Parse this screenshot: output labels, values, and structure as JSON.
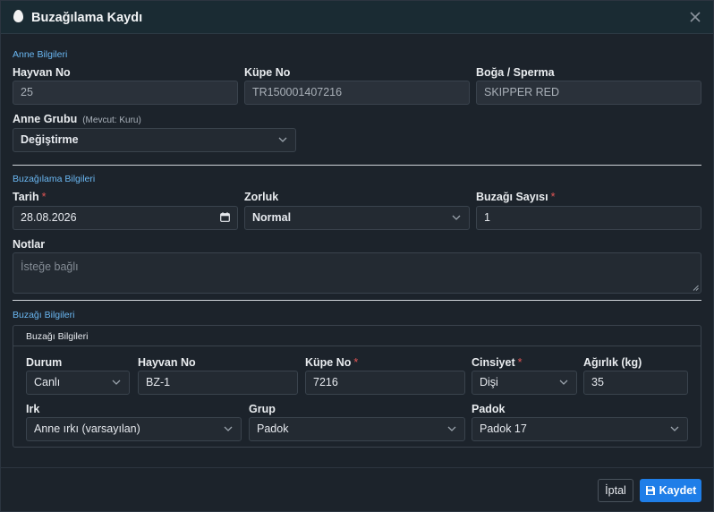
{
  "modal": {
    "title": "Buzağılama Kaydı"
  },
  "mother": {
    "section": "Anne Bilgileri",
    "animal_no_label": "Hayvan No",
    "animal_no_value": "25",
    "tag_no_label": "Küpe No",
    "tag_no_value": "TR150001407216",
    "bull_label": "Boğa / Sperma",
    "bull_value": "SKIPPER RED",
    "group_label": "Anne Grubu",
    "group_hint": "(Mevcut: Kuru)",
    "group_value": "Değiştirme"
  },
  "calving": {
    "section": "Buzağılama Bilgileri",
    "date_label": "Tarih",
    "date_value": "28.08.2026",
    "difficulty_label": "Zorluk",
    "difficulty_value": "Normal",
    "calf_count_label": "Buzağı Sayısı",
    "calf_count_value": "1",
    "required_mark": "*"
  },
  "notes": {
    "label": "Notlar",
    "placeholder": "İsteğe bağlı"
  },
  "calf": {
    "section": "Buzağı Bilgileri",
    "fieldset_title": "Buzağı Bilgileri",
    "status_label": "Durum",
    "status_value": "Canlı",
    "animal_no_label": "Hayvan No",
    "animal_no_value": "BZ-1",
    "tag_no_label": "Küpe No",
    "tag_no_value": "7216",
    "sex_label": "Cinsiyet",
    "sex_value": "Dişi",
    "weight_label": "Ağırlık (kg)",
    "weight_value": "35",
    "breed_label": "Irk",
    "breed_value": "Anne ırkı (varsayılan)",
    "group_label": "Grup",
    "group_value": "Padok",
    "paddock_label": "Padok",
    "paddock_value": "Padok 17"
  },
  "footer": {
    "cancel_label": "İptal",
    "save_label": "Kaydet"
  },
  "colors": {
    "accent": "#1f7ee8",
    "section_label": "#6ab7f2",
    "required": "#e05555"
  },
  "icons": {
    "title": "egg-icon",
    "close": "close-icon",
    "select": "chevron-down-icon",
    "date": "calendar-icon",
    "save": "floppy-disk-icon"
  }
}
